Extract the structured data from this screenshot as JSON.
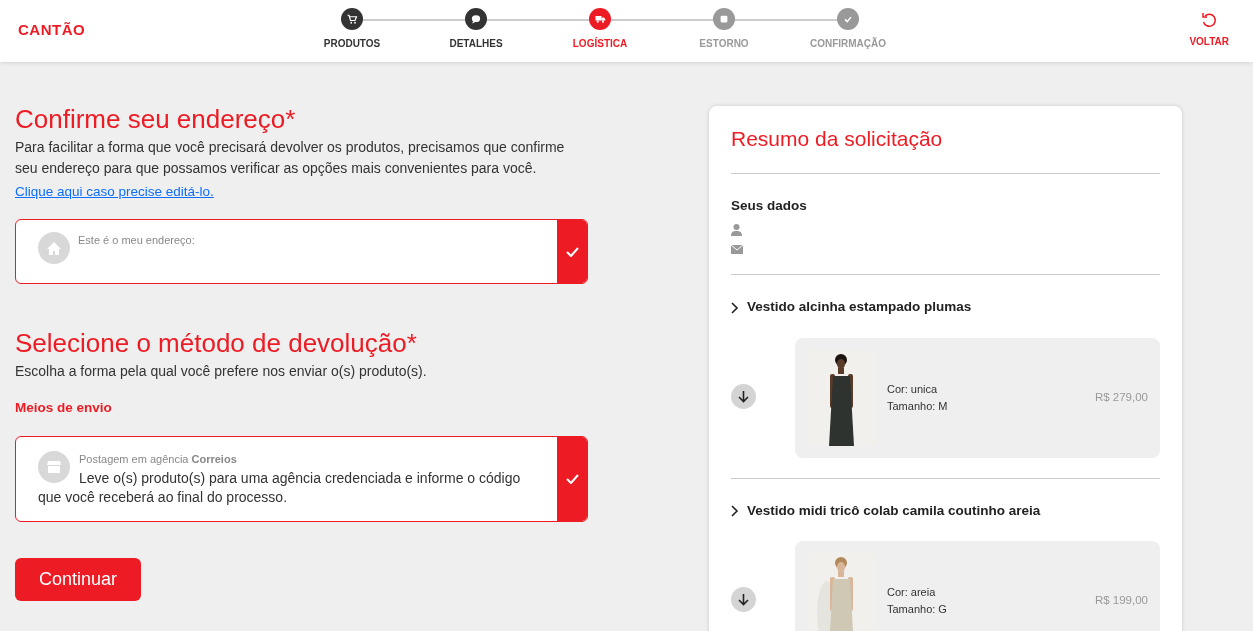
{
  "header": {
    "logo": "CANTÃO",
    "back": "VOLTAR"
  },
  "steps": [
    {
      "label": "PRODUTOS",
      "kind": "done"
    },
    {
      "label": "DETALHES",
      "kind": "done"
    },
    {
      "label": "LOGÍSTICA",
      "kind": "current"
    },
    {
      "label": "ESTORNO",
      "kind": "upcoming"
    },
    {
      "label": "CONFIRMAÇÃO",
      "kind": "upcoming"
    }
  ],
  "address": {
    "title": "Confirme seu endereço*",
    "text": "Para facilitar a forma que você precisará devolver os produtos, precisamos que confirme seu endereço para que possamos verificar as opções mais convenientes para você.",
    "link": "Clique aqui caso precise editá-lo.",
    "option": {
      "label": "Este é o meu endereço:",
      "selected": true
    }
  },
  "method": {
    "title": "Selecione o método de devolução*",
    "text": "Escolha a forma pela qual você prefere nos enviar o(s) produto(s).",
    "subtitle": "Meios de envio",
    "options": [
      {
        "label": "Postagem em agência **Correios**",
        "description": "Leve o(s) produto(s) para uma agência credenciada e informe o código que você receberá ao final do processo.",
        "selected": true
      }
    ]
  },
  "continue_button": "Continuar",
  "summary": {
    "title": "Resumo da solicitação",
    "your_data": "Seus dados",
    "products": [
      {
        "name": "Vestido alcinha estampado plumas",
        "color_text": "Cor: unica",
        "size": "Tamanho: M",
        "price": "R$ 279,00"
      },
      {
        "name": "Vestido midi tricô colab camila coutinho areia",
        "color_text": "Cor: areia",
        "size": "Tamanho: G",
        "price": "R$ 199,00"
      }
    ]
  }
}
